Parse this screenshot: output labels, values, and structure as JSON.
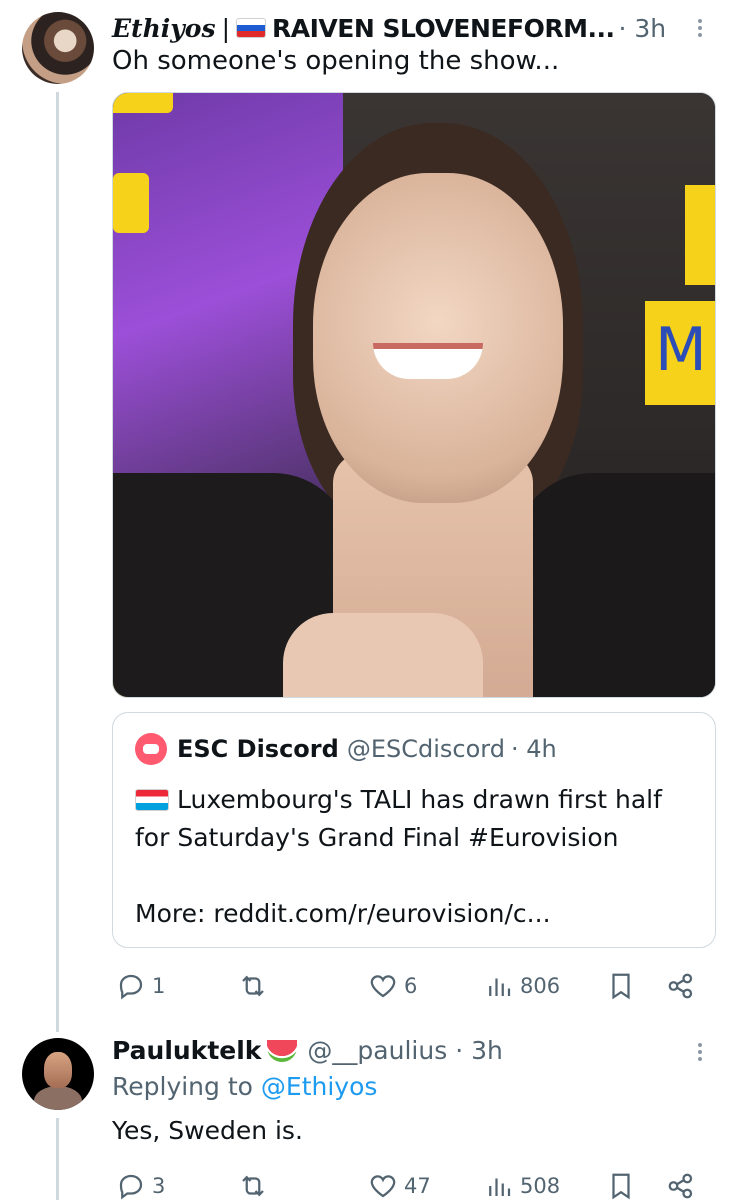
{
  "post1": {
    "author_display": "Ethiyos",
    "separator": "|",
    "author_name_bold": "RAIVEN SLOVENEFORM...",
    "time": "· 3h",
    "text": "Oh someone's opening the show...",
    "media_sign_letter": "M",
    "quote": {
      "name": "ESC Discord",
      "handle": "@ESCdiscord",
      "time": "· 4h",
      "line1": "Luxembourg's TALI has drawn first half",
      "line2": "for Saturday's Grand Final #Eurovision",
      "line3": "More: reddit.com/r/eurovision/c..."
    },
    "actions": {
      "replies": "1",
      "retweets": "",
      "likes": "6",
      "views": "806"
    }
  },
  "post2": {
    "author_name": "Pauluktelk",
    "handle": "@__paulius",
    "time": "· 3h",
    "replying_prefix": "Replying to",
    "replying_to": "@Ethiyos",
    "text": "Yes, Sweden is.",
    "actions": {
      "replies": "3",
      "retweets": "",
      "likes": "47",
      "views": "508"
    }
  },
  "colors": {
    "text": "#0f1419",
    "muted": "#536471",
    "link": "#1d9bf0",
    "border": "#cfd9de"
  }
}
